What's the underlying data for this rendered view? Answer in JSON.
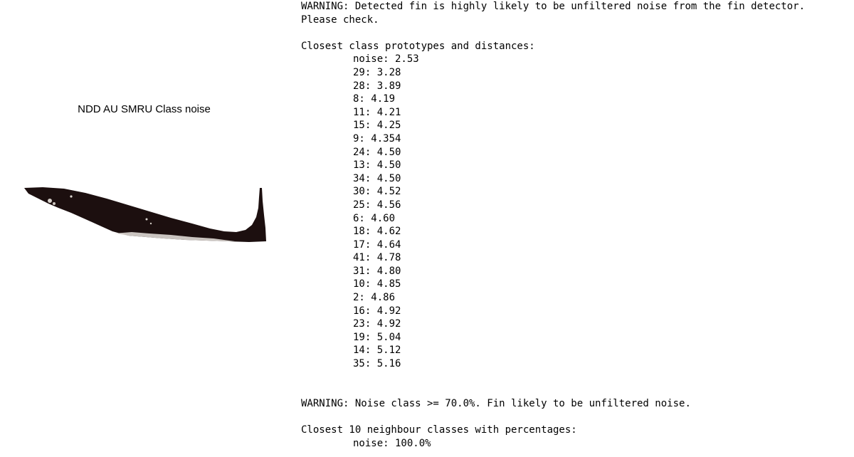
{
  "class_title": "NDD AU SMRU Class noise",
  "warning_detector": [
    "WARNING: Detected fin is highly likely to be unfiltered noise from the fin detector.",
    "Please check."
  ],
  "prototypes": {
    "heading": "Closest class prototypes and distances:",
    "items": [
      "noise: 2.53",
      "29: 3.28",
      "28: 3.89",
      "8: 4.19",
      "11: 4.21",
      "15: 4.25",
      "9: 4.354",
      "24: 4.50",
      "13: 4.50",
      "34: 4.50",
      "30: 4.52",
      "25: 4.56",
      "6: 4.60",
      "18: 4.62",
      "17: 4.64",
      "41: 4.78",
      "31: 4.80",
      "10: 4.85",
      "2: 4.86",
      "16: 4.92",
      "23: 4.92",
      "19: 5.04",
      "14: 5.12",
      "35: 5.16"
    ]
  },
  "warning_noise": "WARNING: Noise class >= 70.0%. Fin likely to be unfiltered noise.",
  "neighbours": {
    "heading": "Closest 10 neighbour classes with percentages:",
    "items": [
      "noise: 100.0%"
    ]
  },
  "colors": {
    "fin_body": "#1c0f0f",
    "fin_highlight": "#e9e4df"
  }
}
